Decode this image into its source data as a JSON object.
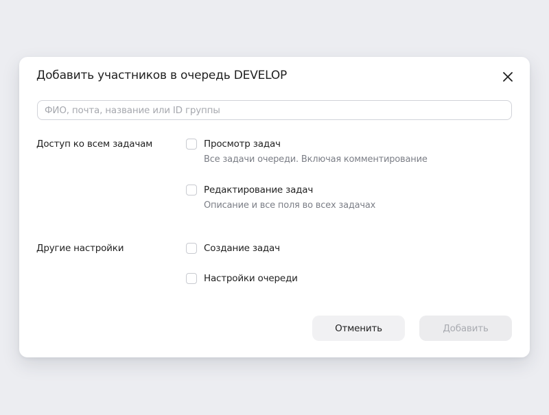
{
  "dialog": {
    "title": "Добавить участников в очередь DEVELOP",
    "close_icon": "close-icon",
    "search": {
      "placeholder": "ФИО, почта, название или ID группы",
      "value": ""
    },
    "sections": [
      {
        "label": "Доступ ко всем задачам",
        "options": [
          {
            "title": "Просмотр задач",
            "description": "Все задачи очереди. Включая комментирование",
            "checked": false
          },
          {
            "title": "Редактирование задач",
            "description": "Описание и все поля во всех задачах",
            "checked": false
          }
        ]
      },
      {
        "label": "Другие настройки",
        "options": [
          {
            "title": "Создание задач",
            "checked": false
          },
          {
            "title": "Настройки очереди",
            "checked": false
          }
        ]
      }
    ],
    "buttons": {
      "cancel_label": "Отменить",
      "add_label": "Добавить",
      "add_disabled": true
    }
  },
  "colors": {
    "backdrop": "#ecedf1",
    "dialog_background": "#ffffff",
    "text_primary": "#1f1f1f",
    "text_secondary": "#7b7e86",
    "placeholder": "#a6a8ae",
    "border": "#d0d2d8",
    "button_secondary": "#f1f1f3",
    "button_disabled": "#ececee",
    "button_disabled_text": "#a9abb1"
  }
}
